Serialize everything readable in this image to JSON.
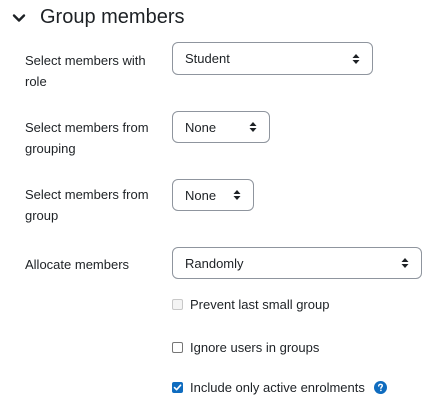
{
  "section": {
    "title": "Group members"
  },
  "fields": {
    "role": {
      "label": "Select members with role",
      "value": "Student"
    },
    "grouping": {
      "label": "Select members from grouping",
      "value": "None"
    },
    "group": {
      "label": "Select members from group",
      "value": "None"
    },
    "allocate": {
      "label": "Allocate members",
      "value": "Randomly"
    }
  },
  "checkboxes": {
    "prevent_last_small_group": {
      "label": "Prevent last small group",
      "checked": false,
      "disabled": true
    },
    "ignore_users_in_groups": {
      "label": "Ignore users in groups",
      "checked": false,
      "disabled": false
    },
    "include_only_active": {
      "label": "Include only active enrolments",
      "checked": true,
      "disabled": false
    }
  },
  "colors": {
    "accent": "#0f6cbf",
    "text": "#1d2125",
    "border": "#8f959e"
  },
  "icons": {
    "collapse": "chevron-down-icon",
    "select_arrows": "sort-arrows-icon",
    "help": "question-circle-icon"
  }
}
